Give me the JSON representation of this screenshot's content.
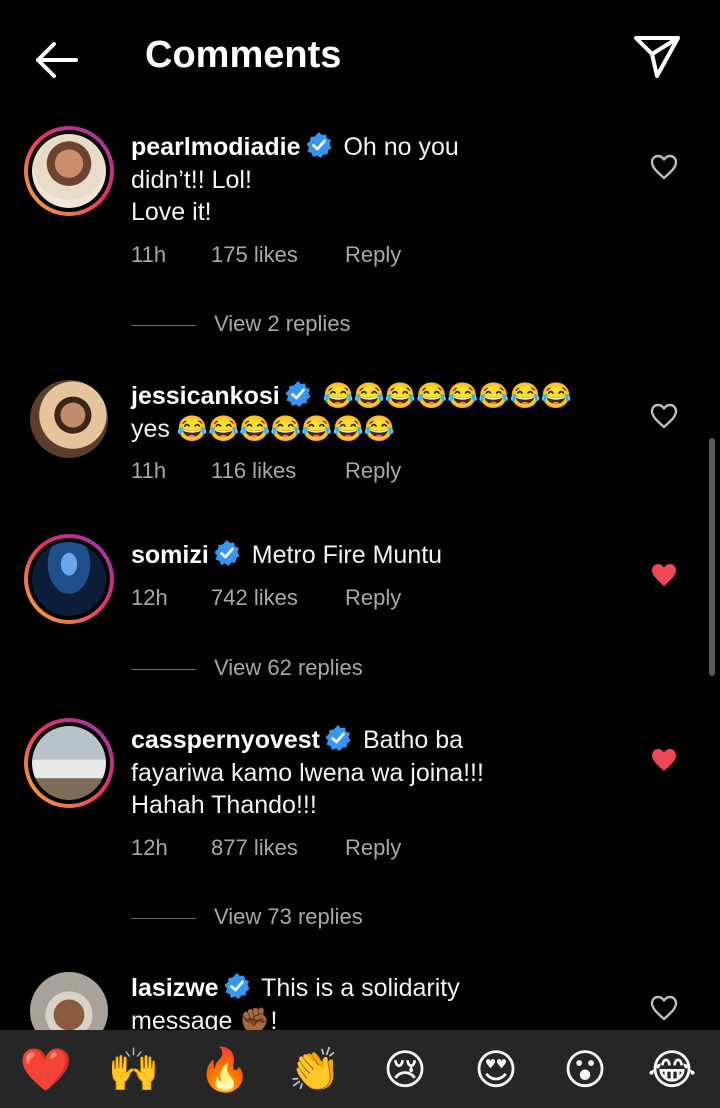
{
  "header": {
    "title": "Comments",
    "back_icon": "arrow-left-icon",
    "share_icon": "paper-plane-icon"
  },
  "colors": {
    "background": "#000000",
    "verified_blue": "#3797f0",
    "liked_red": "#ed4956",
    "muted_text": "#a8a8a8",
    "emoji_bar": "#262626"
  },
  "comments": [
    {
      "username": "pearlmodiadie",
      "verified": true,
      "text": [
        "Oh no you",
        "didn’t!! Lol!",
        "Love it!"
      ],
      "time": "11h",
      "likes": "175 likes",
      "reply": "Reply",
      "liked": false,
      "view_replies": "View 2 replies"
    },
    {
      "username": "jessicankosi",
      "verified": true,
      "text": [
        "😂😂😂😂😂😂😂😂",
        "yes 😂😂😂😂😂😂😂"
      ],
      "time": "11h",
      "likes": "116 likes",
      "reply": "Reply",
      "liked": false
    },
    {
      "username": "somizi",
      "verified": true,
      "text": [
        "Metro Fire Muntu"
      ],
      "time": "12h",
      "likes": "742 likes",
      "reply": "Reply",
      "liked": true,
      "view_replies": "View 62 replies"
    },
    {
      "username": "casspernyovest",
      "verified": true,
      "text": [
        "Batho ba",
        "fayariwa kamo lwena wa joina!!!",
        "Hahah Thando!!!"
      ],
      "time": "12h",
      "likes": "877 likes",
      "reply": "Reply",
      "liked": true,
      "view_replies": "View 73 replies"
    },
    {
      "username": "lasizwe",
      "verified": true,
      "text": [
        "This is a solidarity",
        "message ✊🏾!"
      ],
      "liked": false
    }
  ],
  "emoji_bar": [
    "❤️",
    "🙌",
    "🔥",
    "👏",
    "😢",
    "😍",
    "😮",
    "😂"
  ]
}
